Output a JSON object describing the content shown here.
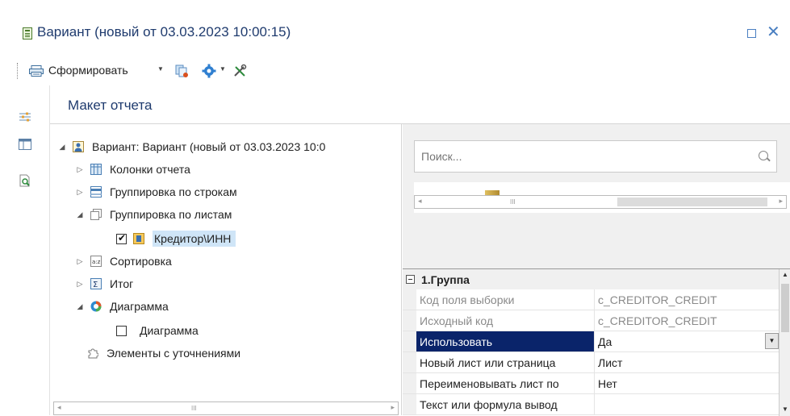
{
  "window": {
    "title": "Вариант (новый от 03.03.2023 10:00:15)",
    "restore_glyph": "",
    "close_glyph": "✕"
  },
  "toolbar": {
    "generate_label": "Сформировать",
    "dropdown_glyph": "▼"
  },
  "section": {
    "title": "Макет отчета"
  },
  "tree": {
    "root": "Вариант: Вариант (новый от 03.03.2023 10:0",
    "items": [
      {
        "label": "Колонки отчета",
        "expander": "▷"
      },
      {
        "label": "Группировка по строкам",
        "expander": "▷"
      },
      {
        "label": "Группировка по листам",
        "expander": "◢"
      },
      {
        "label": "Кредитор\\ИНН",
        "checked": true
      },
      {
        "label": "Сортировка",
        "expander": "▷"
      },
      {
        "label": "Итог",
        "expander": "▷"
      },
      {
        "label": "Диаграмма",
        "expander": "◢"
      },
      {
        "label": "Диаграмма",
        "checked": false
      },
      {
        "label": "Элементы с уточнениями"
      }
    ],
    "root_expander": "◢"
  },
  "search": {
    "placeholder": "Поиск..."
  },
  "scroll": {
    "left_arrow": "◂",
    "right_arrow": "▸",
    "thumb_glyph": "III"
  },
  "properties": {
    "group": "1.Группа",
    "rows": [
      {
        "key": "Код поля выборки",
        "value": "c_CREDITOR_CREDIT"
      },
      {
        "key": "Исходный код",
        "value": "c_CREDITOR_CREDIT"
      },
      {
        "key": "Использовать",
        "value": "Да"
      },
      {
        "key": "Новый лист или страница",
        "value": "Лист"
      },
      {
        "key": "Переименовывать лист по",
        "value": "Нет"
      },
      {
        "key": "Текст или формула вывод",
        "value": ""
      }
    ],
    "drop_glyph": "▼"
  }
}
